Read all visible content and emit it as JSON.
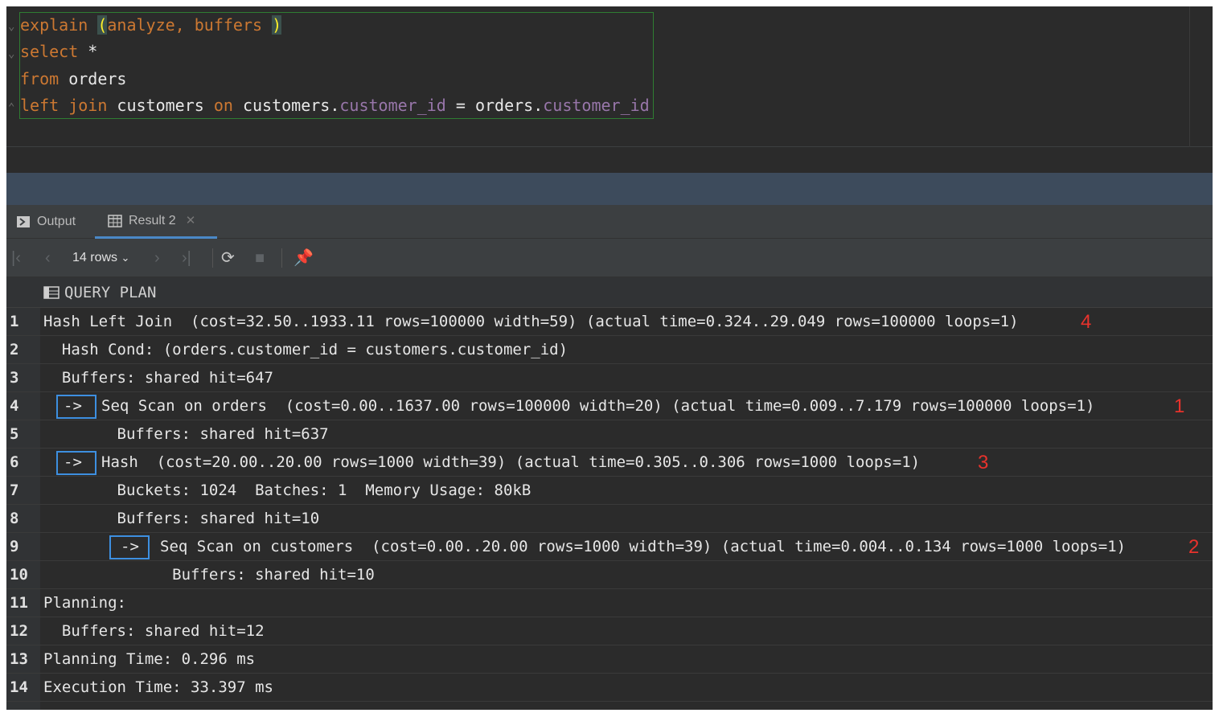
{
  "editor": {
    "lines": [
      {
        "k1": "explain",
        "p1": "(",
        "rest": "analyze, buffers",
        "p2": ")"
      },
      {
        "k1": "select",
        "rest": " *"
      },
      {
        "k1": "from",
        "rest": " orders"
      },
      {
        "k1": "left join",
        "t1": " customers ",
        "k2": "on",
        "t2": " customers.",
        "f1": "customer_id",
        "t3": " = orders.",
        "f2": "customer_id"
      }
    ]
  },
  "tabs": {
    "output_label": "Output",
    "result_label": "Result 2"
  },
  "toolbar": {
    "rows_label": "14 rows"
  },
  "grid": {
    "header": "QUERY PLAN",
    "rows": [
      {
        "n": "1",
        "text": "Hash Left Join  (cost=32.50..1933.11 rows=100000 width=59) (actual time=0.324..29.049 rows=100000 loops=1)",
        "note": "4"
      },
      {
        "n": "2",
        "text": "  Hash Cond: (orders.customer_id = customers.customer_id)"
      },
      {
        "n": "3",
        "text": "  Buffers: shared hit=647"
      },
      {
        "n": "4",
        "arrow": "->",
        "text": "Seq Scan on orders  (cost=0.00..1637.00 rows=100000 width=20) (actual time=0.009..7.179 rows=100000 loops=1)",
        "note": "1"
      },
      {
        "n": "5",
        "text": "        Buffers: shared hit=637"
      },
      {
        "n": "6",
        "arrow": "->",
        "text": "Hash  (cost=20.00..20.00 rows=1000 width=39) (actual time=0.305..0.306 rows=1000 loops=1)",
        "note": "3"
      },
      {
        "n": "7",
        "text": "        Buckets: 1024  Batches: 1  Memory Usage: 80kB"
      },
      {
        "n": "8",
        "text": "        Buffers: shared hit=10"
      },
      {
        "n": "9",
        "arrow": "->",
        "text": "Seq Scan on customers  (cost=0.00..20.00 rows=1000 width=39) (actual time=0.004..0.134 rows=1000 loops=1)",
        "note": "2"
      },
      {
        "n": "10",
        "text": "              Buffers: shared hit=10"
      },
      {
        "n": "11",
        "text": "Planning:"
      },
      {
        "n": "12",
        "text": "  Buffers: shared hit=12"
      },
      {
        "n": "13",
        "text": "Planning Time: 0.296 ms"
      },
      {
        "n": "14",
        "text": "Execution Time: 33.397 ms"
      }
    ]
  },
  "colors": {
    "keyword": "#cc7832",
    "field": "#9876aa",
    "annotation": "#e8322c",
    "highlight_box": "#3d8fe0"
  }
}
